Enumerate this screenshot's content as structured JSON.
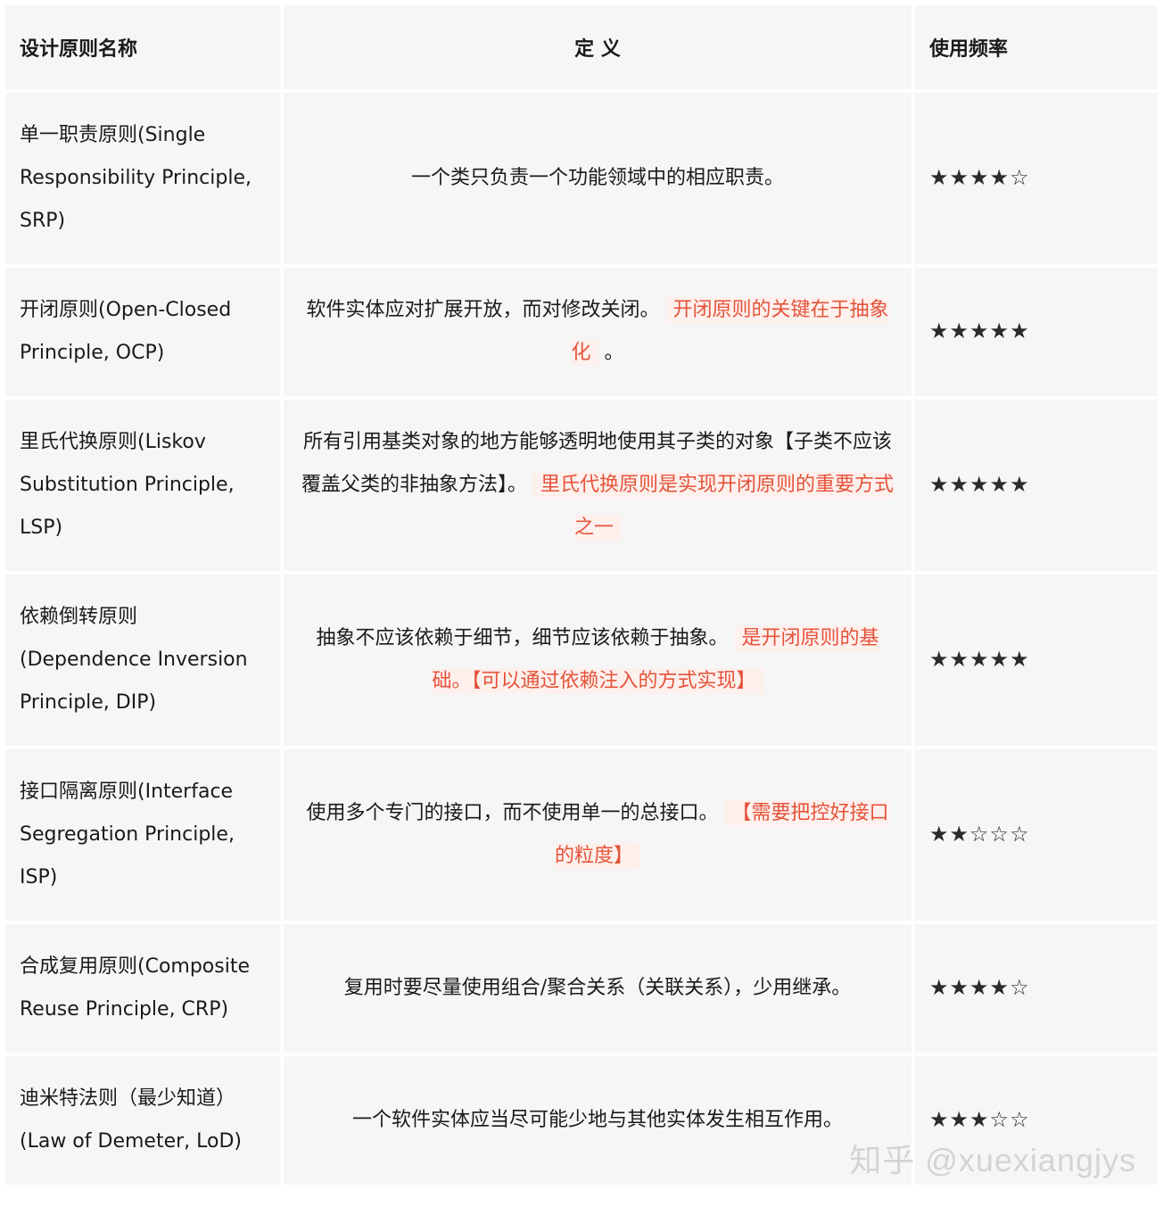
{
  "headers": {
    "name": "设计原则名称",
    "definition": "定 义",
    "frequency": "使用频率"
  },
  "rows": [
    {
      "name": "单一职责原则(Single Responsibility Principle, SRP)",
      "definition": "一个类只负责一个功能领域中的相应职责。",
      "highlight": "",
      "tail": "",
      "stars": "★★★★☆",
      "rating": 4
    },
    {
      "name": "开闭原则(Open-Closed Principle, OCP)",
      "definition": "软件实体应对扩展开放，而对修改关闭。",
      "highlight": "开闭原则的关键在于抽象化",
      "tail": "。",
      "stars": "★★★★★",
      "rating": 5
    },
    {
      "name": "里氏代换原则(Liskov Substitution Principle, LSP)",
      "definition": "所有引用基类对象的地方能够透明地使用其子类的对象【子类不应该覆盖父类的非抽象方法】。",
      "highlight": "里氏代换原则是实现开闭原则的重要方式之一",
      "tail": "",
      "stars": "★★★★★",
      "rating": 5
    },
    {
      "name": "依赖倒转原则(Dependence Inversion Principle, DIP)",
      "definition": "抽象不应该依赖于细节，细节应该依赖于抽象。",
      "highlight": "是开闭原则的基础。【可以通过依赖注入的方式实现】",
      "tail": "",
      "stars": "★★★★★",
      "rating": 5
    },
    {
      "name": "接口隔离原则(Interface Segregation Principle, ISP)",
      "definition": "使用多个专门的接口，而不使用单一的总接口。",
      "highlight": "【需要把控好接口的粒度】",
      "tail": "",
      "stars": "★★☆☆☆",
      "rating": 2
    },
    {
      "name": "合成复用原则(Composite Reuse Principle, CRP)",
      "definition": "复用时要尽量使用组合/聚合关系（关联关系），少用继承。",
      "highlight": "",
      "tail": "",
      "stars": "★★★★☆",
      "rating": 4
    },
    {
      "name": "迪米特法则（最少知道）(Law of Demeter, LoD)",
      "definition": "一个软件实体应当尽可能少地与其他实体发生相互作用。",
      "highlight": "",
      "tail": "",
      "stars": "★★★☆☆",
      "rating": 3
    }
  ],
  "watermark": "知乎 @xuexiangjys",
  "colors": {
    "highlight_text": "#e5533a",
    "highlight_bg": "#fdf0ed",
    "cell_bg": "#f6f6f6"
  }
}
